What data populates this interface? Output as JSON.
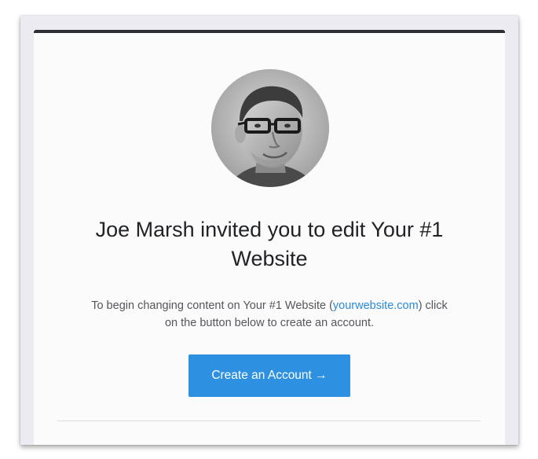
{
  "invite": {
    "headline_line1": "Joe Marsh invited you to edit Your #1",
    "headline_line2": "Website",
    "intro_before_link": "To begin changing content on Your #1 Website (",
    "intro_link": "yourwebsite.com",
    "intro_after_link": ") click",
    "intro_line2": "on the button below to create an account.",
    "button_label": "Create an Account →"
  },
  "colors": {
    "top_border": "#2d2e34",
    "button": "#2d90e0",
    "link": "#2a8ad8",
    "frame": "#ecebf1"
  }
}
